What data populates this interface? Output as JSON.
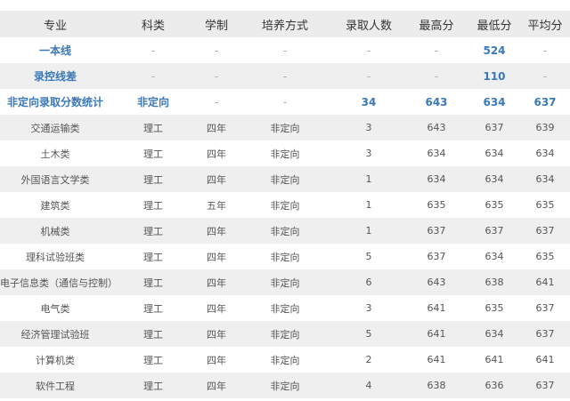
{
  "headers": [
    "专业",
    "科类",
    "学制",
    "培养方式",
    "录取人数",
    "最高分",
    "最低分",
    "平均分"
  ],
  "summary_rows": [
    [
      "一本线",
      "-",
      "-",
      "-",
      "-",
      "-",
      "524",
      "-"
    ],
    [
      "录控线差",
      "-",
      "-",
      "-",
      "-",
      "-",
      "110",
      "-"
    ],
    [
      "非定向录取分数统计",
      "非定向",
      "-",
      "-",
      "34",
      "643",
      "634",
      "637"
    ]
  ],
  "rows": [
    [
      "交通运输类",
      "理工",
      "四年",
      "非定向",
      "3",
      "643",
      "637",
      "639"
    ],
    [
      "土木类",
      "理工",
      "四年",
      "非定向",
      "3",
      "634",
      "634",
      "634"
    ],
    [
      "外国语言文学类",
      "理工",
      "四年",
      "非定向",
      "1",
      "634",
      "634",
      "634"
    ],
    [
      "建筑类",
      "理工",
      "五年",
      "非定向",
      "1",
      "635",
      "635",
      "635"
    ],
    [
      "机械类",
      "理工",
      "四年",
      "非定向",
      "1",
      "637",
      "637",
      "637"
    ],
    [
      "理科试验班类",
      "理工",
      "四年",
      "非定向",
      "5",
      "637",
      "634",
      "635"
    ],
    [
      "电子信息类（通信与控制）",
      "理工",
      "四年",
      "非定向",
      "6",
      "643",
      "638",
      "641"
    ],
    [
      "电气类",
      "理工",
      "四年",
      "非定向",
      "3",
      "641",
      "635",
      "637"
    ],
    [
      "经济管理试验班",
      "理工",
      "四年",
      "非定向",
      "5",
      "641",
      "634",
      "637"
    ],
    [
      "计算机类",
      "理工",
      "四年",
      "非定向",
      "2",
      "641",
      "641",
      "641"
    ],
    [
      "软件工程",
      "理工",
      "四年",
      "非定向",
      "4",
      "638",
      "636",
      "637"
    ]
  ]
}
